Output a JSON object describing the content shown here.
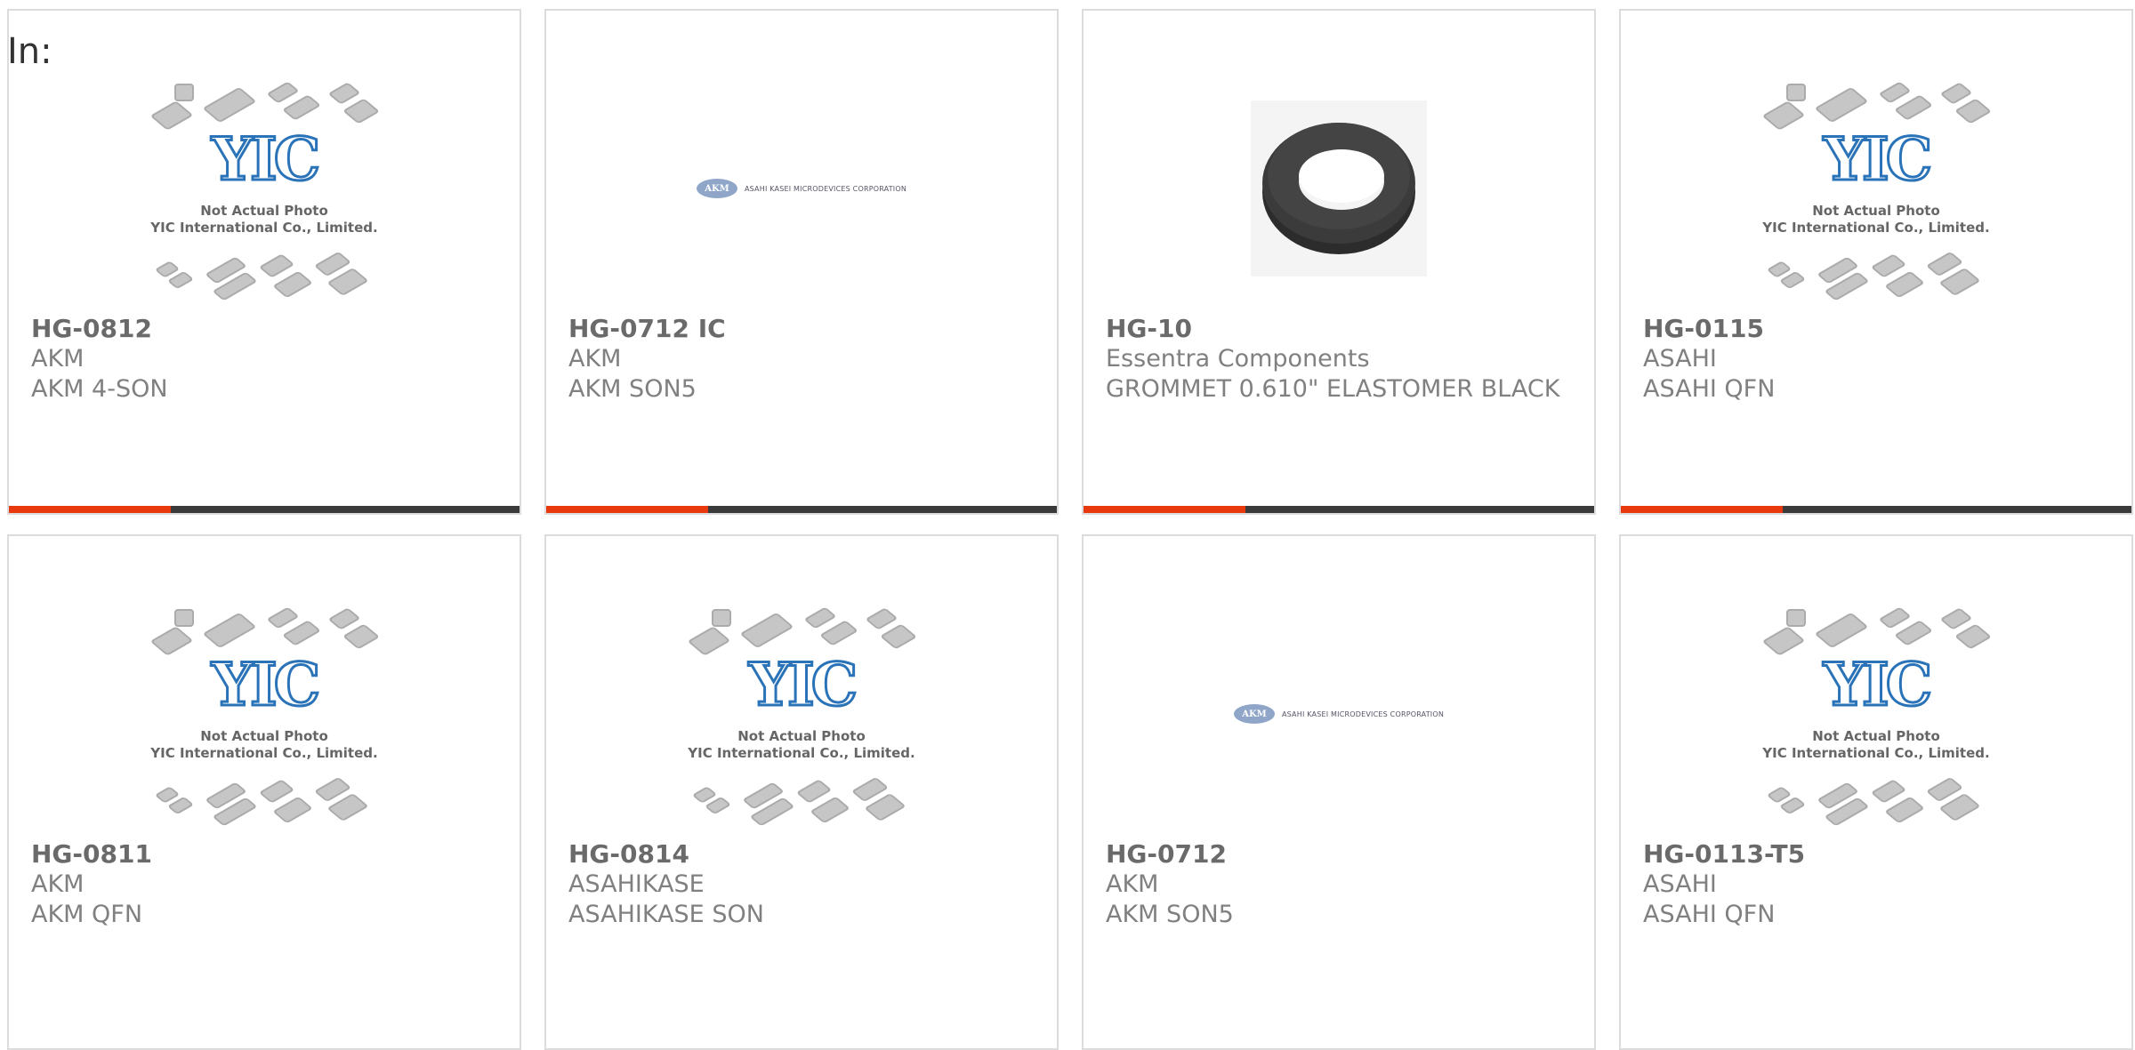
{
  "header": {
    "label": "In:"
  },
  "placeholder": {
    "logo": "YIC",
    "line1": "Not Actual Photo",
    "line2": "YIC International Co., Limited."
  },
  "akm_banner": {
    "oval": "AKM",
    "text": "ASAHI KASEI MICRODEVICES CORPORATION"
  },
  "colors": {
    "accent": "#e8380d",
    "bar": "#3a3a3a",
    "logo_blue": "#2a73b8"
  },
  "products": [
    {
      "part": "HG-0812",
      "mfr": "AKM",
      "desc": "AKM 4-SON",
      "image": "yic-placeholder"
    },
    {
      "part": "HG-0712 IC",
      "mfr": "AKM",
      "desc": "AKM SON5",
      "image": "akm-banner"
    },
    {
      "part": "HG-10",
      "mfr": "Essentra Components",
      "desc": "GROMMET 0.610\" ELASTOMER BLACK",
      "image": "grommet-photo"
    },
    {
      "part": "HG-0115",
      "mfr": "ASAHI",
      "desc": "ASAHI QFN",
      "image": "yic-placeholder"
    },
    {
      "part": "HG-0811",
      "mfr": "AKM",
      "desc": "AKM QFN",
      "image": "yic-placeholder"
    },
    {
      "part": "HG-0814",
      "mfr": "ASAHIKASE",
      "desc": "ASAHIKASE SON",
      "image": "yic-placeholder"
    },
    {
      "part": "HG-0712",
      "mfr": "AKM",
      "desc": "AKM SON5",
      "image": "akm-banner"
    },
    {
      "part": "HG-0113-T5",
      "mfr": "ASAHI",
      "desc": "ASAHI QFN",
      "image": "yic-placeholder"
    }
  ]
}
